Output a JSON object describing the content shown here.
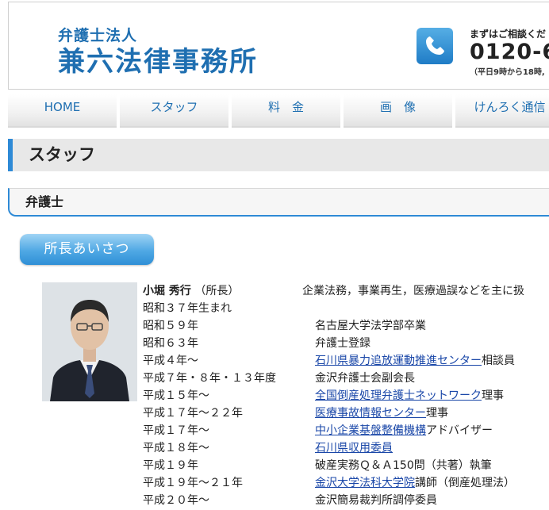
{
  "header": {
    "firm_type": "弁護士法人",
    "firm_name": "兼六法律事務所",
    "consult_text": "まずはご相談くだ",
    "phone_number": "0120-6",
    "hours_text": "（平日9時から18時,"
  },
  "nav": [
    {
      "label": "HOME"
    },
    {
      "label": "スタッフ"
    },
    {
      "label": "料　金"
    },
    {
      "label": "画　像"
    },
    {
      "label": "けんろく通信"
    }
  ],
  "page_title": "スタッフ",
  "section_title": "弁護士",
  "greeting_button": "所長あいさつ",
  "profile": {
    "name": "小堀 秀行",
    "title": "（所長）",
    "specialty": "企業法務，事業再生，医療過誤などを主に扱",
    "history": [
      {
        "period": "昭和３７年生まれ",
        "event": "",
        "link": "",
        "suffix": ""
      },
      {
        "period": "昭和５９年",
        "event": "名古屋大学法学部卒業",
        "link": "",
        "suffix": ""
      },
      {
        "period": "昭和６３年",
        "event": "弁護士登録",
        "link": "",
        "suffix": ""
      },
      {
        "period": "平成４年～",
        "event": "",
        "link": "石川県暴力追放運動推進センター",
        "suffix": "相談員"
      },
      {
        "period": "平成７年・８年・１３年度",
        "event": "金沢弁護士会副会長",
        "link": "",
        "suffix": ""
      },
      {
        "period": "平成１５年～",
        "event": "",
        "link": "全国倒産処理弁護士ネットワーク",
        "suffix": "理事"
      },
      {
        "period": "平成１７年～２２年",
        "event": "",
        "link": "医療事故情報センター",
        "suffix": "理事"
      },
      {
        "period": "平成１７年～",
        "event": "",
        "link": "中小企業基盤整備機構",
        "suffix": "アドバイザー"
      },
      {
        "period": "平成１８年～",
        "event": "",
        "link": "石川県収用委員",
        "suffix": ""
      },
      {
        "period": "平成１９年",
        "event": "破産実務Ｑ＆Ａ150問（共著）執筆",
        "link": "",
        "suffix": ""
      },
      {
        "period": "平成１９年～２１年",
        "event": "",
        "link": "金沢大学法科大学院",
        "suffix": "講師（倒産処理法）"
      },
      {
        "period": "平成２０年～",
        "event": "金沢簡易裁判所調停委員",
        "link": "",
        "suffix": ""
      }
    ]
  },
  "colors": {
    "brand": "#1f6fb1",
    "accent": "#2e8ad6",
    "link": "#1a47a8"
  },
  "icons": {
    "phone": "phone-icon"
  }
}
